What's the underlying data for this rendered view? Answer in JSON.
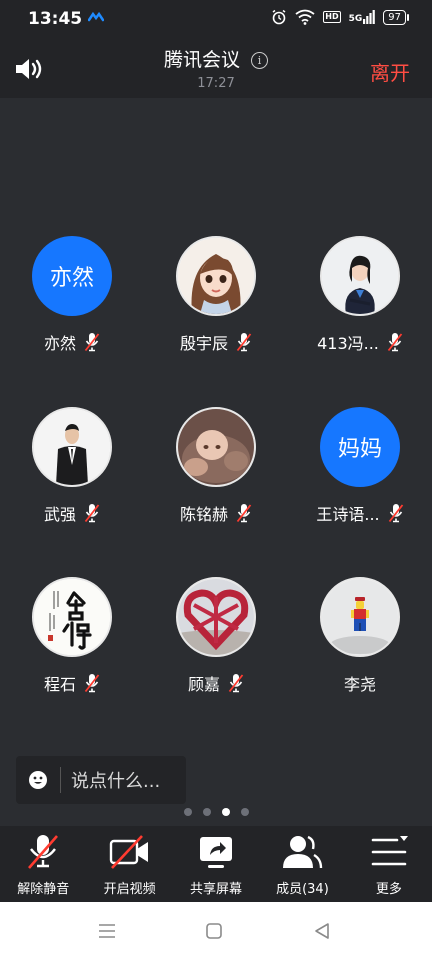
{
  "status_bar": {
    "time": "13:45",
    "signal_label": "5G",
    "hd_label": "HD",
    "battery": "97",
    "icons": [
      "alarm-icon",
      "wifi-icon",
      "hd-icon",
      "signal-icon",
      "battery-icon"
    ]
  },
  "header": {
    "title": "腾讯会议",
    "duration": "17:27",
    "leave_label": "离开",
    "info_glyph": "i"
  },
  "participants": [
    {
      "name": "亦然",
      "avatar_text": "亦然",
      "avatar_type": "text",
      "muted": true
    },
    {
      "name": "殷宇辰",
      "avatar_type": "cartoon-girl",
      "muted": true
    },
    {
      "name": "413冯...",
      "avatar_type": "woman-portrait",
      "muted": true
    },
    {
      "name": "武强",
      "avatar_type": "man-in-suit",
      "muted": true
    },
    {
      "name": "陈铭赫",
      "avatar_type": "baby-photo",
      "muted": true
    },
    {
      "name": "王诗语...",
      "avatar_text": "妈妈",
      "avatar_type": "text",
      "muted": true
    },
    {
      "name": "程石",
      "avatar_type": "calligraphy",
      "muted": true
    },
    {
      "name": "顾嘉",
      "avatar_type": "red-heart-sculpture",
      "muted": true
    },
    {
      "name": "李尧",
      "avatar_type": "lego-figure",
      "muted": false
    }
  ],
  "chat": {
    "placeholder": "说点什么..."
  },
  "pagination": {
    "total": 4,
    "current": 3
  },
  "toolbar": {
    "unmute": "解除静音",
    "video": "开启视频",
    "share": "共享屏幕",
    "members": "成员(34)",
    "more": "更多"
  },
  "colors": {
    "background": "#2b2d31",
    "bar": "#232427",
    "accent_blue": "#1677ff",
    "leave_red": "#ff4d43",
    "mute_red": "#ff3b30"
  }
}
